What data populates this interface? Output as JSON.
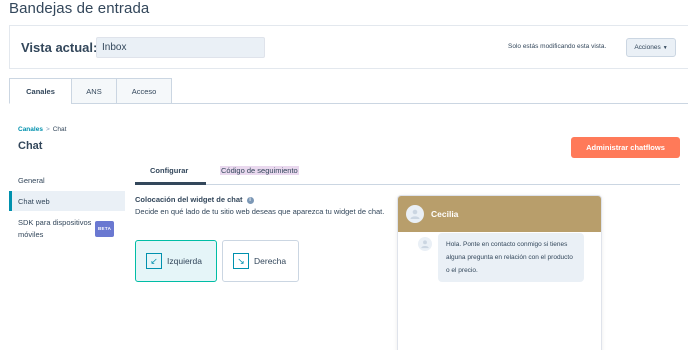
{
  "page": {
    "title": "Bandejas de entrada"
  },
  "view_bar": {
    "label": "Vista actual:",
    "input_value": "Inbox",
    "note": "Solo estás modificando esta vista.",
    "actions_label": "Acciones"
  },
  "tabs": [
    {
      "label": "Canales",
      "active": true
    },
    {
      "label": "ANS",
      "active": false
    },
    {
      "label": "Acceso",
      "active": false
    }
  ],
  "breadcrumb": {
    "parent": "Canales",
    "separator": ">",
    "current": "Chat"
  },
  "section_title": "Chat",
  "manage_button": "Administrar chatflows",
  "sidebar": {
    "items": [
      {
        "label": "General"
      },
      {
        "label": "Chat web",
        "active": true
      },
      {
        "label": "SDK para dispositivos móviles",
        "badge": "BETA"
      }
    ]
  },
  "subtabs": [
    {
      "label": "Configurar",
      "active": true
    },
    {
      "label": "Código de seguimiento",
      "active": false
    }
  ],
  "placement": {
    "title": "Colocación del widget de chat",
    "description": "Decide en qué lado de tu sitio web deseas que aparezca tu widget de chat.",
    "options": [
      {
        "label": "Izquierda",
        "selected": true
      },
      {
        "label": "Derecha",
        "selected": false
      }
    ]
  },
  "preview": {
    "agent_name": "Cecilia",
    "message": "Hola. Ponte en contacto conmigo si tienes alguna pregunta en relación con el producto o el precio."
  },
  "colors": {
    "accent_orange": "#ff7a59",
    "header_tan": "#b89e6b",
    "selected_teal": "#00bda5",
    "link": "#0091ae",
    "beta_badge": "#6a78d1",
    "text": "#33475b"
  },
  "icons": {
    "info": "info-icon",
    "caret": "caret-down-icon",
    "left_arrow": "arrow-down-left-icon",
    "right_arrow": "arrow-down-right-icon",
    "avatar": "user-avatar-icon"
  }
}
